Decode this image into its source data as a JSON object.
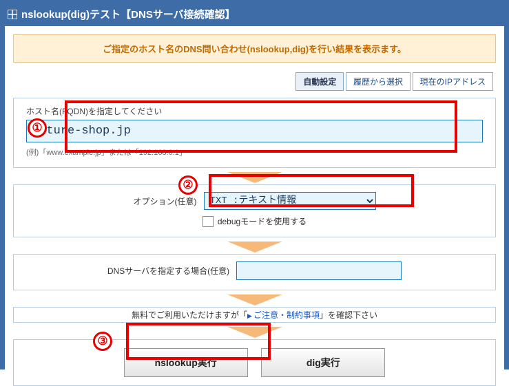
{
  "header": {
    "title": "nslookup(dig)テスト【DNSサーバ接続確認】"
  },
  "banner": {
    "text": "ご指定のホスト名のDNS問い合わせ(nslookup,dig)を行い結果を表示ます。"
  },
  "tabs": {
    "auto": "自動設定",
    "history": "履歴から選択",
    "current_ip": "現在のIPアドレス"
  },
  "host_section": {
    "label": "ホスト名(FQDN)を指定してください",
    "value": "future-shop.jp",
    "hint": "(例)「www.example.jp」または「192.168.0.1」"
  },
  "option_section": {
    "label": "オプション(任意)",
    "selected": "TXT  :テキスト情報",
    "debug_label": "debugモードを使用する"
  },
  "dns_section": {
    "label": "DNSサーバを指定する場合(任意)",
    "value": ""
  },
  "notice": {
    "prefix": "無料でご利用いただけますが「",
    "link": "ご注意・制約事項",
    "suffix": "」を確認下さい"
  },
  "buttons": {
    "nslookup": "nslookup実行",
    "dig": "dig実行"
  },
  "callouts": {
    "n1": "①",
    "n2": "②",
    "n3": "③"
  }
}
